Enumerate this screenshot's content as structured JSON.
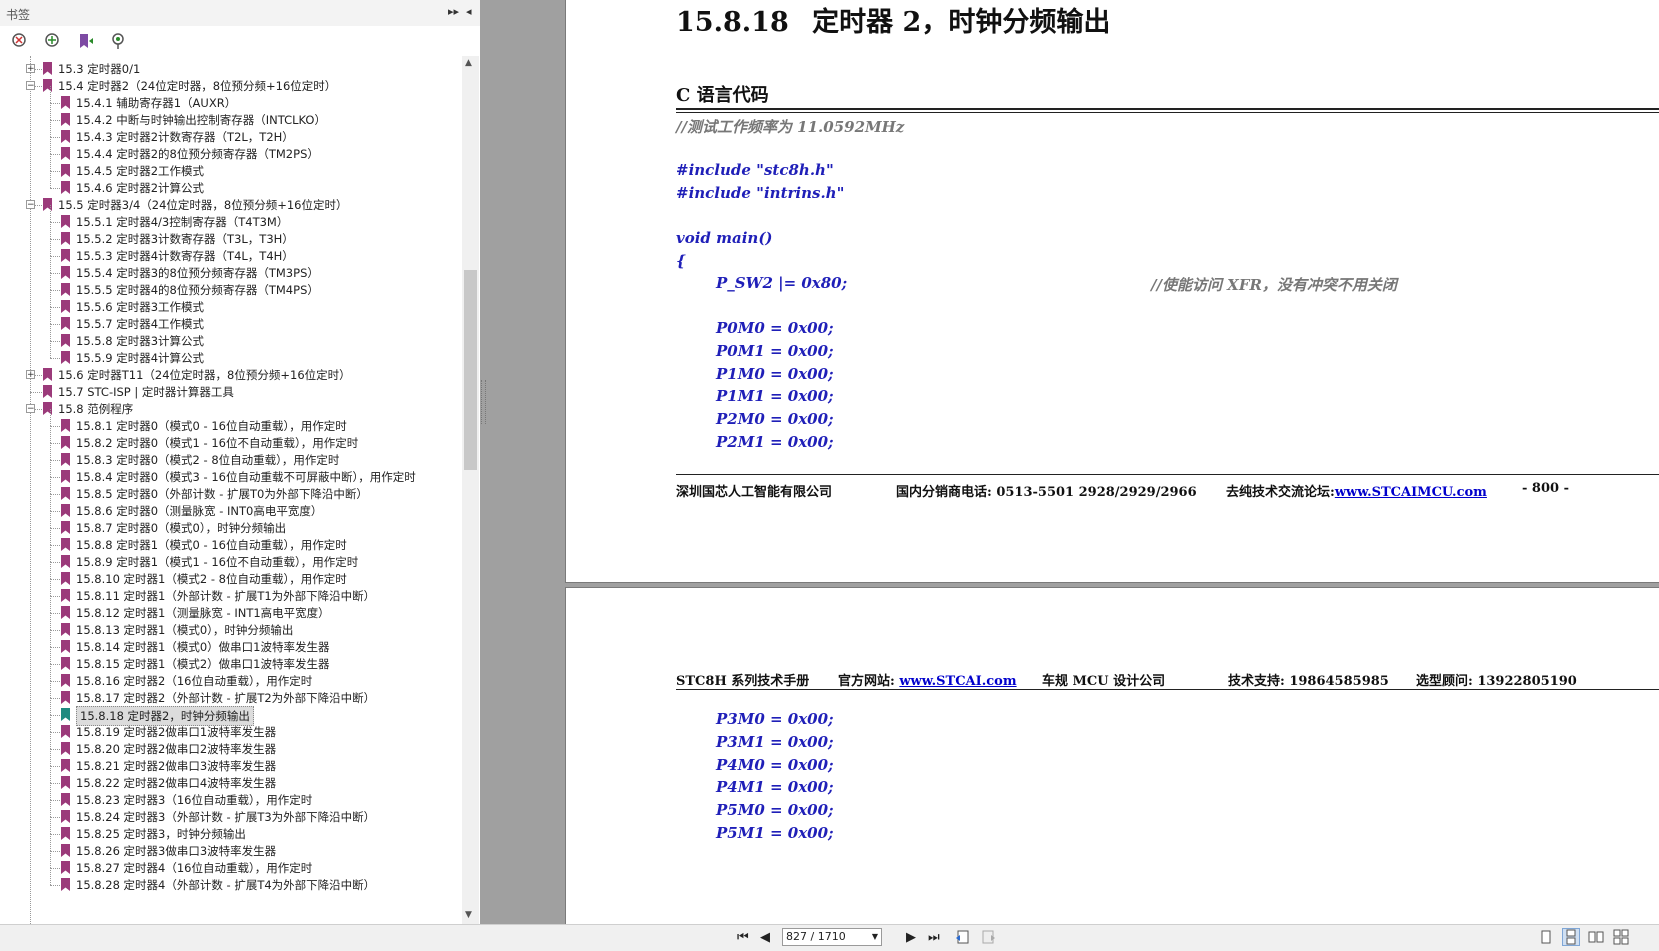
{
  "panel": {
    "title": "书签",
    "bookmarks": [
      {
        "label": "15.3  定时器0/1",
        "level": 1,
        "expander": "+"
      },
      {
        "label": "15.4  定时器2（24位定时器，8位预分频+16位定时）",
        "level": 1,
        "expander": "−"
      },
      {
        "label": "15.4.1 辅助寄存器1（AUXR）",
        "level": 2
      },
      {
        "label": "15.4.2 中断与时钟输出控制寄存器（INTCLKO）",
        "level": 2
      },
      {
        "label": "15.4.3 定时器2计数寄存器（T2L，T2H）",
        "level": 2
      },
      {
        "label": "15.4.4 定时器2的8位预分频寄存器（TM2PS）",
        "level": 2
      },
      {
        "label": "15.4.5  定时器2工作模式",
        "level": 2
      },
      {
        "label": "15.4.6 定时器2计算公式",
        "level": 2
      },
      {
        "label": "15.5  定时器3/4（24位定时器，8位预分频+16位定时）",
        "level": 1,
        "expander": "−"
      },
      {
        "label": "15.5.1 定时器4/3控制寄存器（T4T3M）",
        "level": 2
      },
      {
        "label": "15.5.2  定时器3计数寄存器（T3L，T3H）",
        "level": 2
      },
      {
        "label": "15.5.3 定时器4计数寄存器（T4L，T4H）",
        "level": 2
      },
      {
        "label": "15.5.4 定时器3的8位预分频寄存器（TM3PS）",
        "level": 2
      },
      {
        "label": "15.5.5 定时器4的8位预分频寄存器（TM4PS）",
        "level": 2
      },
      {
        "label": "15.5.6  定时器3工作模式",
        "level": 2
      },
      {
        "label": "15.5.7  定时器4工作模式",
        "level": 2
      },
      {
        "label": "15.5.8  定时器3计算公式",
        "level": 2
      },
      {
        "label": "15.5.9 定时器4计算公式",
        "level": 2
      },
      {
        "label": "15.6  定时器T11（24位定时器，8位预分频+16位定时）",
        "level": 1,
        "expander": "+"
      },
      {
        "label": "15.7  STC-ISP | 定时器计算器工具",
        "level": 1
      },
      {
        "label": "15.8  范例程序",
        "level": 1,
        "expander": "−"
      },
      {
        "label": "15.8.1 定时器0（模式0 - 16位自动重载），用作定时",
        "level": 2
      },
      {
        "label": "15.8.2 定时器0（模式1 - 16位不自动重载），用作定时",
        "level": 2
      },
      {
        "label": "15.8.3 定时器0（模式2 - 8位自动重载），用作定时",
        "level": 2
      },
      {
        "label": "15.8.4 定时器0（模式3 - 16位自动重载不可屏蔽中断），用作定时",
        "level": 2
      },
      {
        "label": "15.8.5 定时器0（外部计数 - 扩展T0为外部下降沿中断）",
        "level": 2
      },
      {
        "label": "15.8.6 定时器0（测量脉宽 - INT0高电平宽度）",
        "level": 2
      },
      {
        "label": "15.8.7 定时器0（模式0），时钟分频输出",
        "level": 2
      },
      {
        "label": "15.8.8 定时器1（模式0 - 16位自动重载），用作定时",
        "level": 2
      },
      {
        "label": "15.8.9 定时器1（模式1 - 16位不自动重载），用作定时",
        "level": 2
      },
      {
        "label": "15.8.10 定时器1（模式2 - 8位自动重载），用作定时",
        "level": 2
      },
      {
        "label": "15.8.11 定时器1（外部计数 - 扩展T1为外部下降沿中断）",
        "level": 2
      },
      {
        "label": "15.8.12 定时器1（测量脉宽 - INT1高电平宽度）",
        "level": 2
      },
      {
        "label": "15.8.13 定时器1（模式0），时钟分频输出",
        "level": 2
      },
      {
        "label": "15.8.14 定时器1（模式0）做串口1波特率发生器",
        "level": 2
      },
      {
        "label": "15.8.15 定时器1（模式2）做串口1波特率发生器",
        "level": 2
      },
      {
        "label": "15.8.16 定时器2（16位自动重载），用作定时",
        "level": 2
      },
      {
        "label": "15.8.17 定时器2（外部计数 - 扩展T2为外部下降沿中断）",
        "level": 2
      },
      {
        "label": "15.8.18 定时器2，时钟分频输出",
        "level": 2,
        "selected": true
      },
      {
        "label": "15.8.19 定时器2做串口1波特率发生器",
        "level": 2
      },
      {
        "label": "15.8.20 定时器2做串口2波特率发生器",
        "level": 2
      },
      {
        "label": "15.8.21 定时器2做串口3波特率发生器",
        "level": 2
      },
      {
        "label": "15.8.22 定时器2做串口4波特率发生器",
        "level": 2
      },
      {
        "label": "15.8.23 定时器3（16位自动重载），用作定时",
        "level": 2
      },
      {
        "label": "15.8.24 定时器3（外部计数 - 扩展T3为外部下降沿中断）",
        "level": 2
      },
      {
        "label": "15.8.25 定时器3，时钟分频输出",
        "level": 2
      },
      {
        "label": "15.8.26 定时器3做串口3波特率发生器",
        "level": 2
      },
      {
        "label": "15.8.27 定时器4（16位自动重载），用作定时",
        "level": 2
      },
      {
        "label": "15.8.28 定时器4（外部计数 - 扩展T4为外部下降沿中断）",
        "level": 2
      }
    ]
  },
  "page1": {
    "heading_num": "15.8.18",
    "heading_text": "定时器 2，时钟分频输出",
    "subheading": "C 语言代码",
    "code_lines": [
      {
        "text": "//测试工作频率为 11.0592MHz",
        "kind": "comment",
        "indent": 0
      },
      {
        "text": "#include \"stc8h.h\"",
        "kind": "code",
        "indent": 0
      },
      {
        "text": "#include \"intrins.h\"",
        "kind": "code",
        "indent": 0
      },
      {
        "text": "void main()",
        "kind": "code",
        "indent": 0
      },
      {
        "text": "{",
        "kind": "code",
        "indent": 0
      },
      {
        "text": "P_SW2 |= 0x80;",
        "kind": "code",
        "indent": 1,
        "comment": "//使能访问 XFR，没有冲突不用关闭"
      },
      {
        "text": "P0M0 = 0x00;",
        "kind": "code",
        "indent": 1
      },
      {
        "text": "P0M1 = 0x00;",
        "kind": "code",
        "indent": 1
      },
      {
        "text": "P1M0 = 0x00;",
        "kind": "code",
        "indent": 1
      },
      {
        "text": "P1M1 = 0x00;",
        "kind": "code",
        "indent": 1
      },
      {
        "text": "P2M0 = 0x00;",
        "kind": "code",
        "indent": 1
      },
      {
        "text": "P2M1 = 0x00;",
        "kind": "code",
        "indent": 1
      }
    ],
    "footer": {
      "company": "深圳国芯人工智能有限公司",
      "phone": "国内分销商电话: 0513-5501 2928/2929/2966",
      "forum_label": "去纯技术交流论坛:",
      "forum_link": "www.STCAIMCU.com",
      "page_num": "- 800 -"
    }
  },
  "page2": {
    "header": {
      "manual": "STC8H 系列技术手册",
      "site_label": "官方网站:",
      "site_link": "www.STCAI.com",
      "slogan": "车规 MCU 设计公司",
      "support": "技术支持: 19864585985",
      "advisor": "选型顾问: 13922805190"
    },
    "code_lines": [
      {
        "text": "P3M0 = 0x00;"
      },
      {
        "text": "P3M1 = 0x00;"
      },
      {
        "text": "P4M0 = 0x00;"
      },
      {
        "text": "P4M1 = 0x00;"
      },
      {
        "text": "P5M0 = 0x00;"
      },
      {
        "text": "P5M1 = 0x00;"
      }
    ]
  },
  "navbar": {
    "page_indicator": "827 / 1710"
  },
  "colors": {
    "bookmark_icon": "#9b3a7a",
    "bookmark_icon_selected": "#1e8a80",
    "code": "#1f1fb8",
    "comment": "#777777",
    "link": "#0000cc"
  }
}
